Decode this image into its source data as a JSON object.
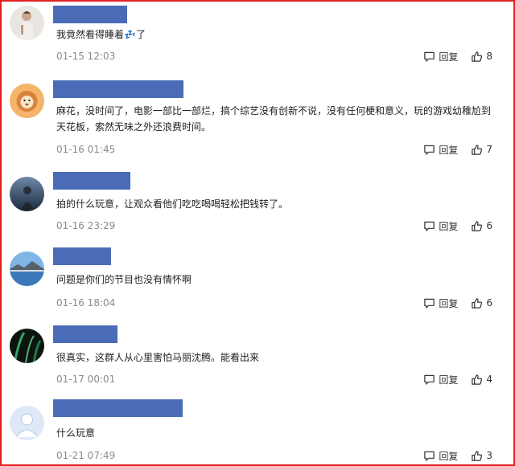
{
  "comments": [
    {
      "text": "我竟然看得睡着💤了",
      "time": "01-15 12:03",
      "reply_label": "回复",
      "likes": "8"
    },
    {
      "text": "麻花，没时间了，电影一部比一部烂，搞个综艺没有创新不说，没有任何梗和意义，玩的游戏幼稚尬到天花板，索然无味之外还浪费时间。",
      "time": "01-16 01:45",
      "reply_label": "回复",
      "likes": "7"
    },
    {
      "text": "拍的什么玩意，让观众看他们吃吃喝喝轻松把钱转了。",
      "time": "01-16 23:29",
      "reply_label": "回复",
      "likes": "6"
    },
    {
      "text": "问题是你们的节目也没有情怀啊",
      "time": "01-16 18:04",
      "reply_label": "回复",
      "likes": "6"
    },
    {
      "text": "很真实，这群人从心里害怕马丽沈腾。能看出来",
      "time": "01-17 00:01",
      "reply_label": "回复",
      "likes": "4"
    },
    {
      "text": "什么玩意",
      "time": "01-21 07:49",
      "reply_label": "回复",
      "likes": "3"
    }
  ],
  "colors": {
    "name_redaction": "#4a6cb7",
    "frame_border": "#e0201f",
    "meta_text": "#8a8a8a"
  },
  "icons": {
    "reply": "comment-bubble-icon",
    "like": "thumbs-up-icon"
  }
}
